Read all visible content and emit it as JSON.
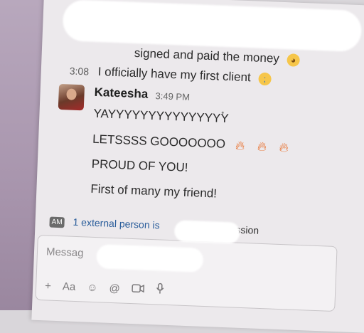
{
  "messages": {
    "line1": {
      "text": "signed and paid the money"
    },
    "line2": {
      "time": "3:08",
      "text": "I officially have my first client"
    }
  },
  "kateesha": {
    "author": "Kateesha",
    "time": "3:49 PM",
    "lines": [
      "YAYYYYYYYYYYYYYYY",
      "LETSSSS GOOOOOOO",
      "PROUD OF YOU!",
      "First of many my friend!"
    ]
  },
  "external_notice": {
    "badge": "AM",
    "text": "1 external person is",
    "suffix": "ssion"
  },
  "composer": {
    "placeholder": "Messag",
    "tools": {
      "plus": "+",
      "format": "Aa",
      "emoji": "☺",
      "mention": "@"
    }
  },
  "icons": [
    "emoji-worried-face-icon",
    "emoji-crying-face-icon",
    "fire-icon",
    "video-icon",
    "microphone-icon"
  ]
}
